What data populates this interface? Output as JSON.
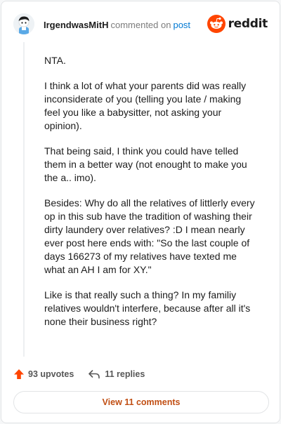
{
  "comment": {
    "author": "IrgendwasMitH",
    "verb": "commented on",
    "post_link": "post",
    "paragraphs": [
      "NTA.",
      "I think a lot of what your parents did was really inconsiderate of you (telling you late / making feel you like a babysitter, not asking your opinion).",
      "That being said, I think you could have telled them in a better way (not enought to make you the a.. imo).",
      "Besides: Why do all the relatives of littlerly every op in this sub have the tradition of washing their dirty laundery over relatives? :D I mean nearly ever post here ends with: \"So the last couple of days 166273 of my relatives have texted me what an AH I am for XY.\"",
      "Like is that really such a thing? In my familiy relatives wouldn't interfere, because after all it's none their business right?"
    ]
  },
  "brand": {
    "name": "reddit",
    "color": "#ff4500"
  },
  "actions": {
    "upvotes_label": "93 upvotes",
    "replies_label": "11 replies"
  },
  "view_comments_label": "View 11 comments",
  "colors": {
    "accent_orange": "#ff4500",
    "link_blue": "#0079d3",
    "view_text": "#c14f14"
  },
  "icons": {
    "avatar": "snoo-avatar",
    "brand_logo": "reddit-snoo-icon",
    "upvote": "upvote-arrow-icon",
    "reply": "reply-arrow-icon"
  }
}
